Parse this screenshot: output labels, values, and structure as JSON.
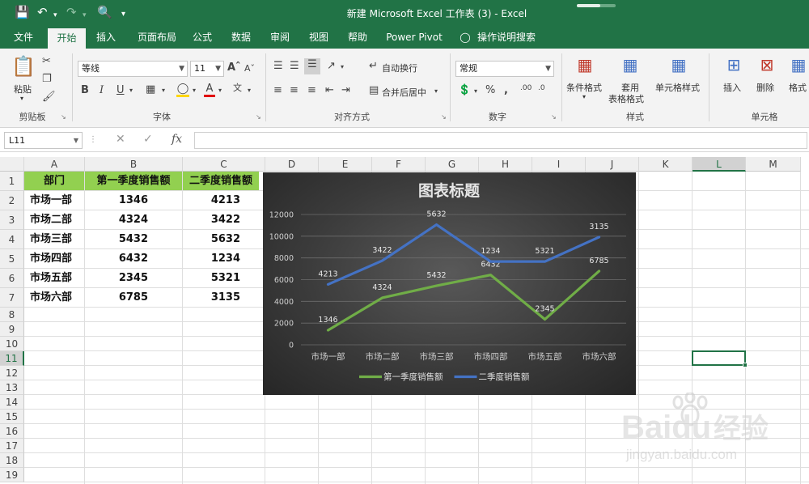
{
  "titlebar": {
    "title": "新建 Microsoft Excel 工作表 (3)  -  Excel",
    "progress": 0.6
  },
  "ribbon_tabs": [
    "文件",
    "开始",
    "插入",
    "页面布局",
    "公式",
    "数据",
    "审阅",
    "视图",
    "帮助",
    "Power Pivot",
    "操作说明搜索"
  ],
  "active_tab": "开始",
  "ribbon": {
    "clipboard": {
      "paste_label": "粘贴",
      "group_label": "剪贴板"
    },
    "font": {
      "font_name": "等线",
      "font_size": "11",
      "group_label": "字体",
      "bold": "B",
      "italic": "I",
      "underline": "U"
    },
    "alignment": {
      "wrap_label": "自动换行",
      "merge_label": "合并后居中",
      "group_label": "对齐方式"
    },
    "number": {
      "format": "常规",
      "group_label": "数字"
    },
    "styles": {
      "conditional": "条件格式",
      "table_format_1": "套用",
      "table_format_2": "表格格式",
      "cell_styles": "单元格样式",
      "group_label": "样式"
    },
    "cells": {
      "insert": "插入",
      "delete": "删除",
      "format": "格式",
      "group_label": "单元格"
    }
  },
  "formula_bar": {
    "name_box": "L11",
    "fx": "fx",
    "value": ""
  },
  "grid": {
    "columns": [
      "A",
      "B",
      "C",
      "D",
      "E",
      "F",
      "G",
      "H",
      "I",
      "J",
      "K",
      "L",
      "M"
    ],
    "rows": [
      "1",
      "2",
      "3",
      "4",
      "5",
      "6",
      "7",
      "8",
      "9",
      "10",
      "11",
      "12",
      "13",
      "14",
      "15",
      "16",
      "17",
      "18",
      "19"
    ],
    "selected_cell": "L11",
    "header": [
      "部门",
      "第一季度销售额",
      "二季度销售额"
    ],
    "data": [
      [
        "市场一部",
        "1346",
        "4213"
      ],
      [
        "市场二部",
        "4324",
        "3422"
      ],
      [
        "市场三部",
        "5432",
        "5632"
      ],
      [
        "市场四部",
        "6432",
        "1234"
      ],
      [
        "市场五部",
        "2345",
        "5321"
      ],
      [
        "市场六部",
        "6785",
        "3135"
      ]
    ]
  },
  "chart_data": {
    "type": "line",
    "title": "图表标题",
    "categories": [
      "市场一部",
      "市场二部",
      "市场三部",
      "市场四部",
      "市场五部",
      "市场六部"
    ],
    "series": [
      {
        "name": "第一季度销售额",
        "color": "#70ad47",
        "values": [
          1346,
          4324,
          5432,
          6432,
          2345,
          6785
        ],
        "labels": [
          "1346",
          "4324",
          "5432",
          "6432",
          "2345",
          "6785"
        ]
      },
      {
        "name": "二季度销售额",
        "color": "#4472c4",
        "values": [
          5559,
          7746,
          11064,
          7666,
          7666,
          9920
        ],
        "labels": [
          "4213",
          "3422",
          "5632",
          "1234",
          "5321",
          "3135"
        ]
      }
    ],
    "y_ticks": [
      "0",
      "2000",
      "4000",
      "6000",
      "8000",
      "10000",
      "12000"
    ],
    "ylim": [
      0,
      12000
    ],
    "grid": true,
    "legend": "bottom",
    "background": "#404040"
  },
  "watermark": {
    "brand": "Baidu",
    "cn": "经验",
    "url": "jingyan.baidu.com"
  }
}
